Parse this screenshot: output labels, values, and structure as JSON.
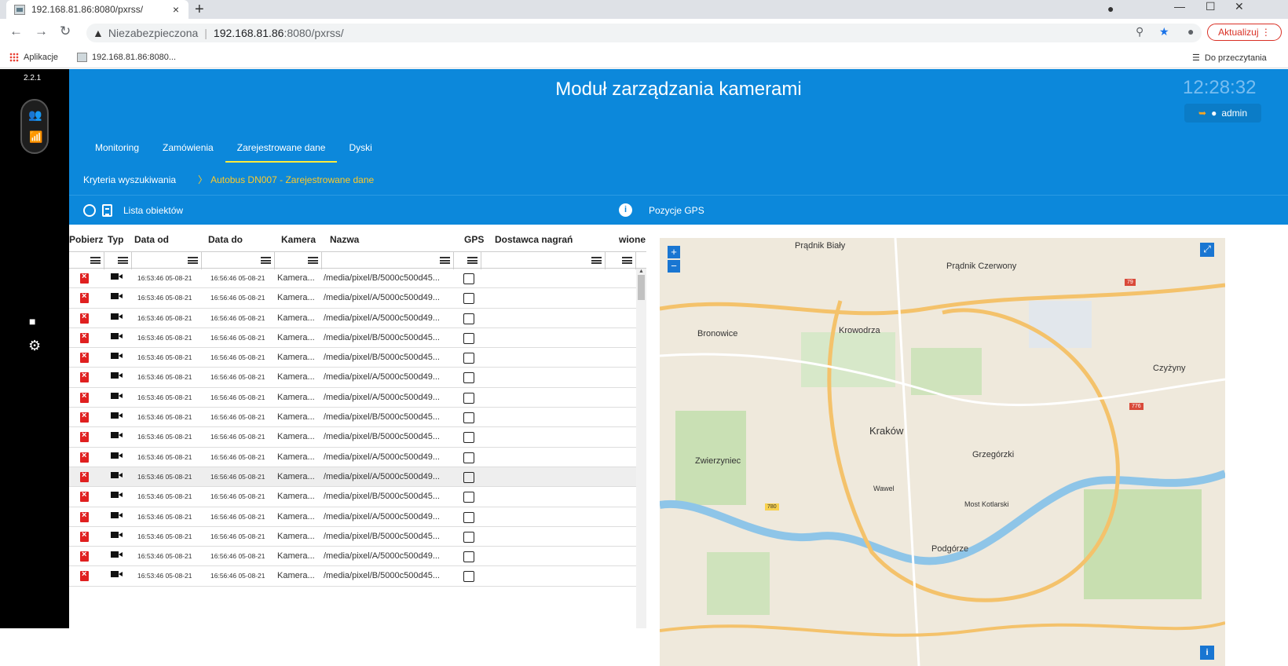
{
  "browser": {
    "tab_title": "192.168.81.86:8080/pxrss/",
    "tab_close": "×",
    "new_tab": "+",
    "url_warning": "Niezabezpieczona",
    "url_host": "192.168.81.86",
    "url_rest": ":8080/pxrss/",
    "update_label": "Aktualizuj",
    "bookmarks_apps": "Aplikacje",
    "bookmark_1": "192.168.81.86:8080...",
    "reading_list": "Do przeczytania"
  },
  "app": {
    "version": "2.2.1",
    "title": "Moduł zarządzania kamerami",
    "clock": "12:28:32",
    "user": "admin",
    "nav_tabs": [
      "Monitoring",
      "Zamówienia",
      "Zarejestrowane dane",
      "Dyski"
    ],
    "active_tab": "Zarejestrowane dane",
    "breadcrumb_1": "Kryteria wyszukiwania",
    "breadcrumb_2": "Autobus DN007 - Zarejestrowane dane",
    "list_title": "Lista obiektów",
    "gps_title": "Pozycje GPS"
  },
  "table": {
    "columns": [
      "Pobierz",
      "Typ",
      "Data od",
      "Data do",
      "Kamera",
      "Nazwa",
      "GPS",
      "Dostawca nagrań",
      "wione"
    ],
    "rows": [
      {
        "from": "16:53:46 05-08-21",
        "to": "16:56:46 05-08-21",
        "camera": "Kamera...",
        "name": "/media/pixel/B/5000c500d45..."
      },
      {
        "from": "16:53:46 05-08-21",
        "to": "16:56:46 05-08-21",
        "camera": "Kamera...",
        "name": "/media/pixel/A/5000c500d49..."
      },
      {
        "from": "16:53:46 05-08-21",
        "to": "16:56:46 05-08-21",
        "camera": "Kamera...",
        "name": "/media/pixel/A/5000c500d49..."
      },
      {
        "from": "16:53:46 05-08-21",
        "to": "16:56:46 05-08-21",
        "camera": "Kamera...",
        "name": "/media/pixel/B/5000c500d45..."
      },
      {
        "from": "16:53:46 05-08-21",
        "to": "16:56:46 05-08-21",
        "camera": "Kamera...",
        "name": "/media/pixel/B/5000c500d45..."
      },
      {
        "from": "16:53:46 05-08-21",
        "to": "16:56:46 05-08-21",
        "camera": "Kamera...",
        "name": "/media/pixel/A/5000c500d49..."
      },
      {
        "from": "16:53:46 05-08-21",
        "to": "16:56:46 05-08-21",
        "camera": "Kamera...",
        "name": "/media/pixel/A/5000c500d49..."
      },
      {
        "from": "16:53:46 05-08-21",
        "to": "16:56:46 05-08-21",
        "camera": "Kamera...",
        "name": "/media/pixel/B/5000c500d45..."
      },
      {
        "from": "16:53:46 05-08-21",
        "to": "16:56:46 05-08-21",
        "camera": "Kamera...",
        "name": "/media/pixel/B/5000c500d45..."
      },
      {
        "from": "16:53:46 05-08-21",
        "to": "16:56:46 05-08-21",
        "camera": "Kamera...",
        "name": "/media/pixel/A/5000c500d49..."
      },
      {
        "from": "16:53:46 05-08-21",
        "to": "16:56:46 05-08-21",
        "camera": "Kamera...",
        "name": "/media/pixel/A/5000c500d49..."
      },
      {
        "from": "16:53:46 05-08-21",
        "to": "16:56:46 05-08-21",
        "camera": "Kamera...",
        "name": "/media/pixel/B/5000c500d45..."
      },
      {
        "from": "16:53:46 05-08-21",
        "to": "16:56:46 05-08-21",
        "camera": "Kamera...",
        "name": "/media/pixel/A/5000c500d49..."
      },
      {
        "from": "16:53:46 05-08-21",
        "to": "16:56:46 05-08-21",
        "camera": "Kamera...",
        "name": "/media/pixel/B/5000c500d45..."
      },
      {
        "from": "16:53:46 05-08-21",
        "to": "16:56:46 05-08-21",
        "camera": "Kamera...",
        "name": "/media/pixel/A/5000c500d49..."
      },
      {
        "from": "16:53:46 05-08-21",
        "to": "16:56:46 05-08-21",
        "camera": "Kamera...",
        "name": "/media/pixel/B/5000c500d45..."
      }
    ],
    "selected_row": 10
  },
  "map": {
    "zoom_in": "+",
    "zoom_out": "−",
    "labels": [
      "Prądnik Biały",
      "Prądnik Czerwony",
      "Bronowice",
      "Krowodrza",
      "Kraków",
      "Czyżyny",
      "Zwierzyniec",
      "Grzegórzki",
      "Podgórze",
      "Wawel",
      "Most Kotlarski"
    ],
    "badges": [
      "79",
      "776",
      "780"
    ]
  },
  "colors": {
    "header": "#0c88db",
    "accent_yellow": "#ffca28",
    "delete_red": "#e02020"
  }
}
